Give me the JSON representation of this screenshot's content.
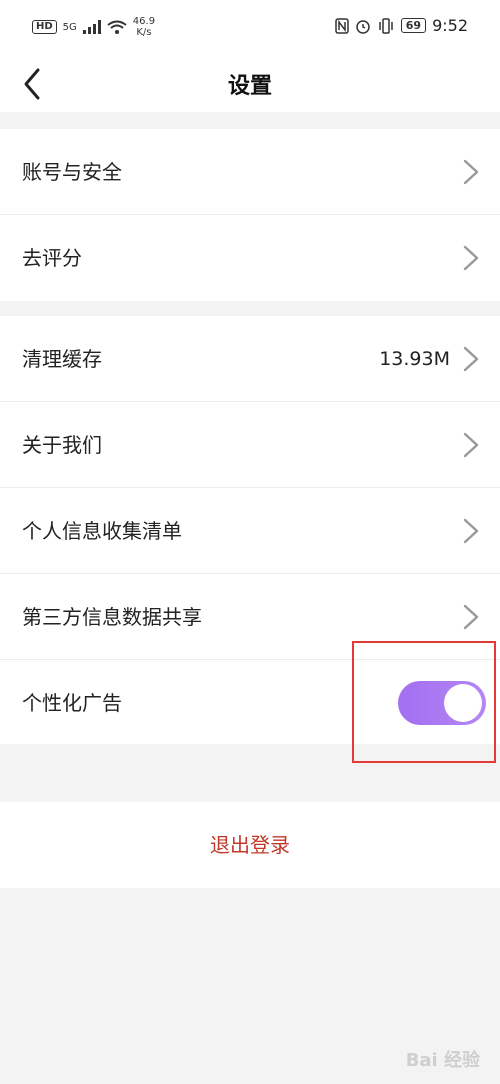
{
  "status_bar": {
    "hd": "HD",
    "network": "5G",
    "speed": "46.9",
    "speed_unit": "K/s",
    "battery": "69",
    "time": "9:52"
  },
  "navbar": {
    "title": "设置"
  },
  "group1": [
    {
      "label": "账号与安全"
    },
    {
      "label": "去评分"
    }
  ],
  "group2": [
    {
      "label": "清理缓存",
      "value": "13.93M"
    },
    {
      "label": "关于我们"
    },
    {
      "label": "个人信息收集清单"
    },
    {
      "label": "第三方信息数据共享"
    },
    {
      "label": "个性化广告",
      "toggle_on": true
    }
  ],
  "logout": "退出登录",
  "watermark": "Bai 经验",
  "colors": {
    "accent_toggle": "#a26ff0",
    "logout_text": "#c0392b",
    "highlight": "#e53935"
  }
}
